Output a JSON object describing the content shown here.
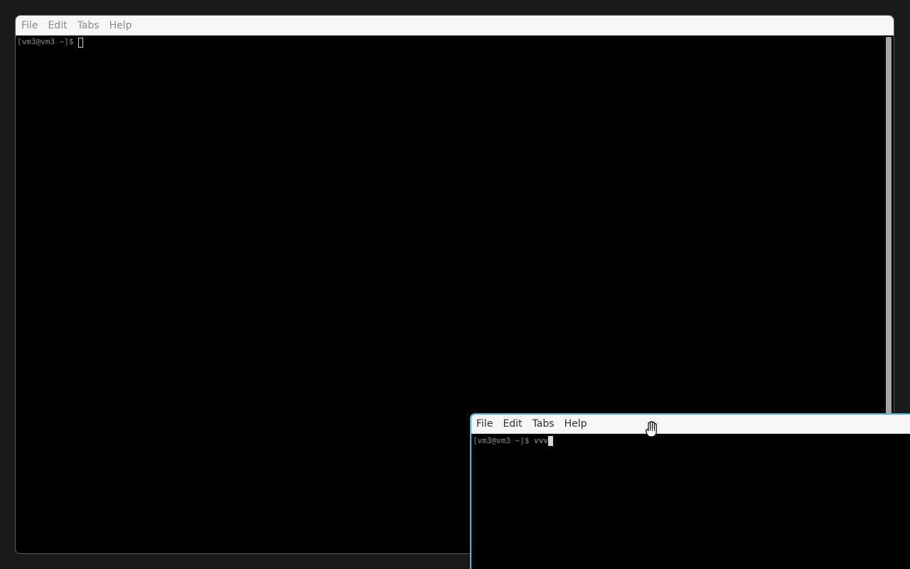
{
  "back_window": {
    "menu": [
      "File",
      "Edit",
      "Tabs",
      "Help"
    ],
    "prompt": "[vm3@vm3 ~]$"
  },
  "front_window": {
    "menu": [
      "File",
      "Edit",
      "Tabs",
      "Help"
    ],
    "prompt": "[vm3@vm3 ~]$",
    "typed": "vvv"
  },
  "icons": {
    "pointer": "grab-hand-cursor-icon",
    "back_cursor": "hollow-block-cursor",
    "front_cursor": "solid-block-cursor"
  },
  "colors": {
    "active_border": "#4fb5e6",
    "terminal_bg": "#000000",
    "menubar_bg": "#f6f6f6",
    "desktop_bg": "#1a1a1a"
  }
}
